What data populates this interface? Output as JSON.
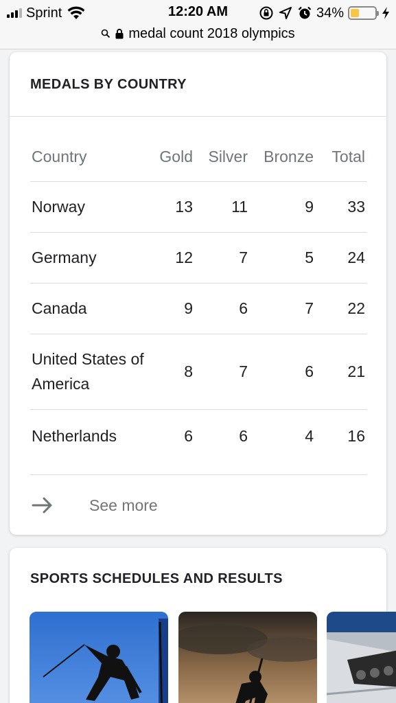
{
  "status_bar": {
    "carrier": "Sprint",
    "time": "12:20 AM",
    "battery_percent": "34%",
    "battery_level": 0.34,
    "battery_color": "#f7c744",
    "icons": [
      "signal-icon",
      "wifi-icon",
      "orientation-lock-icon",
      "location-icon",
      "alarm-icon",
      "battery-icon",
      "charging-icon"
    ]
  },
  "url_bar": {
    "text": "medal count 2018 olympics",
    "icons": [
      "search-icon",
      "lock-icon"
    ]
  },
  "medals_card": {
    "title": "MEDALS BY COUNTRY",
    "columns": [
      "Country",
      "Gold",
      "Silver",
      "Bronze",
      "Total"
    ],
    "rows": [
      {
        "country": "Norway",
        "gold": "13",
        "silver": "11",
        "bronze": "9",
        "total": "33"
      },
      {
        "country": "Germany",
        "gold": "12",
        "silver": "7",
        "bronze": "5",
        "total": "24"
      },
      {
        "country": "Canada",
        "gold": "9",
        "silver": "6",
        "bronze": "7",
        "total": "22"
      },
      {
        "country": "United States of America",
        "gold": "8",
        "silver": "7",
        "bronze": "6",
        "total": "21"
      },
      {
        "country": "Netherlands",
        "gold": "6",
        "silver": "6",
        "bronze": "4",
        "total": "16"
      }
    ],
    "see_more": "See more"
  },
  "sports_card": {
    "title": "SPORTS SCHEDULES AND RESULTS",
    "thumbnails": [
      "alpine-skiing-image",
      "snowboarding-image",
      "bobsleigh-image"
    ]
  }
}
